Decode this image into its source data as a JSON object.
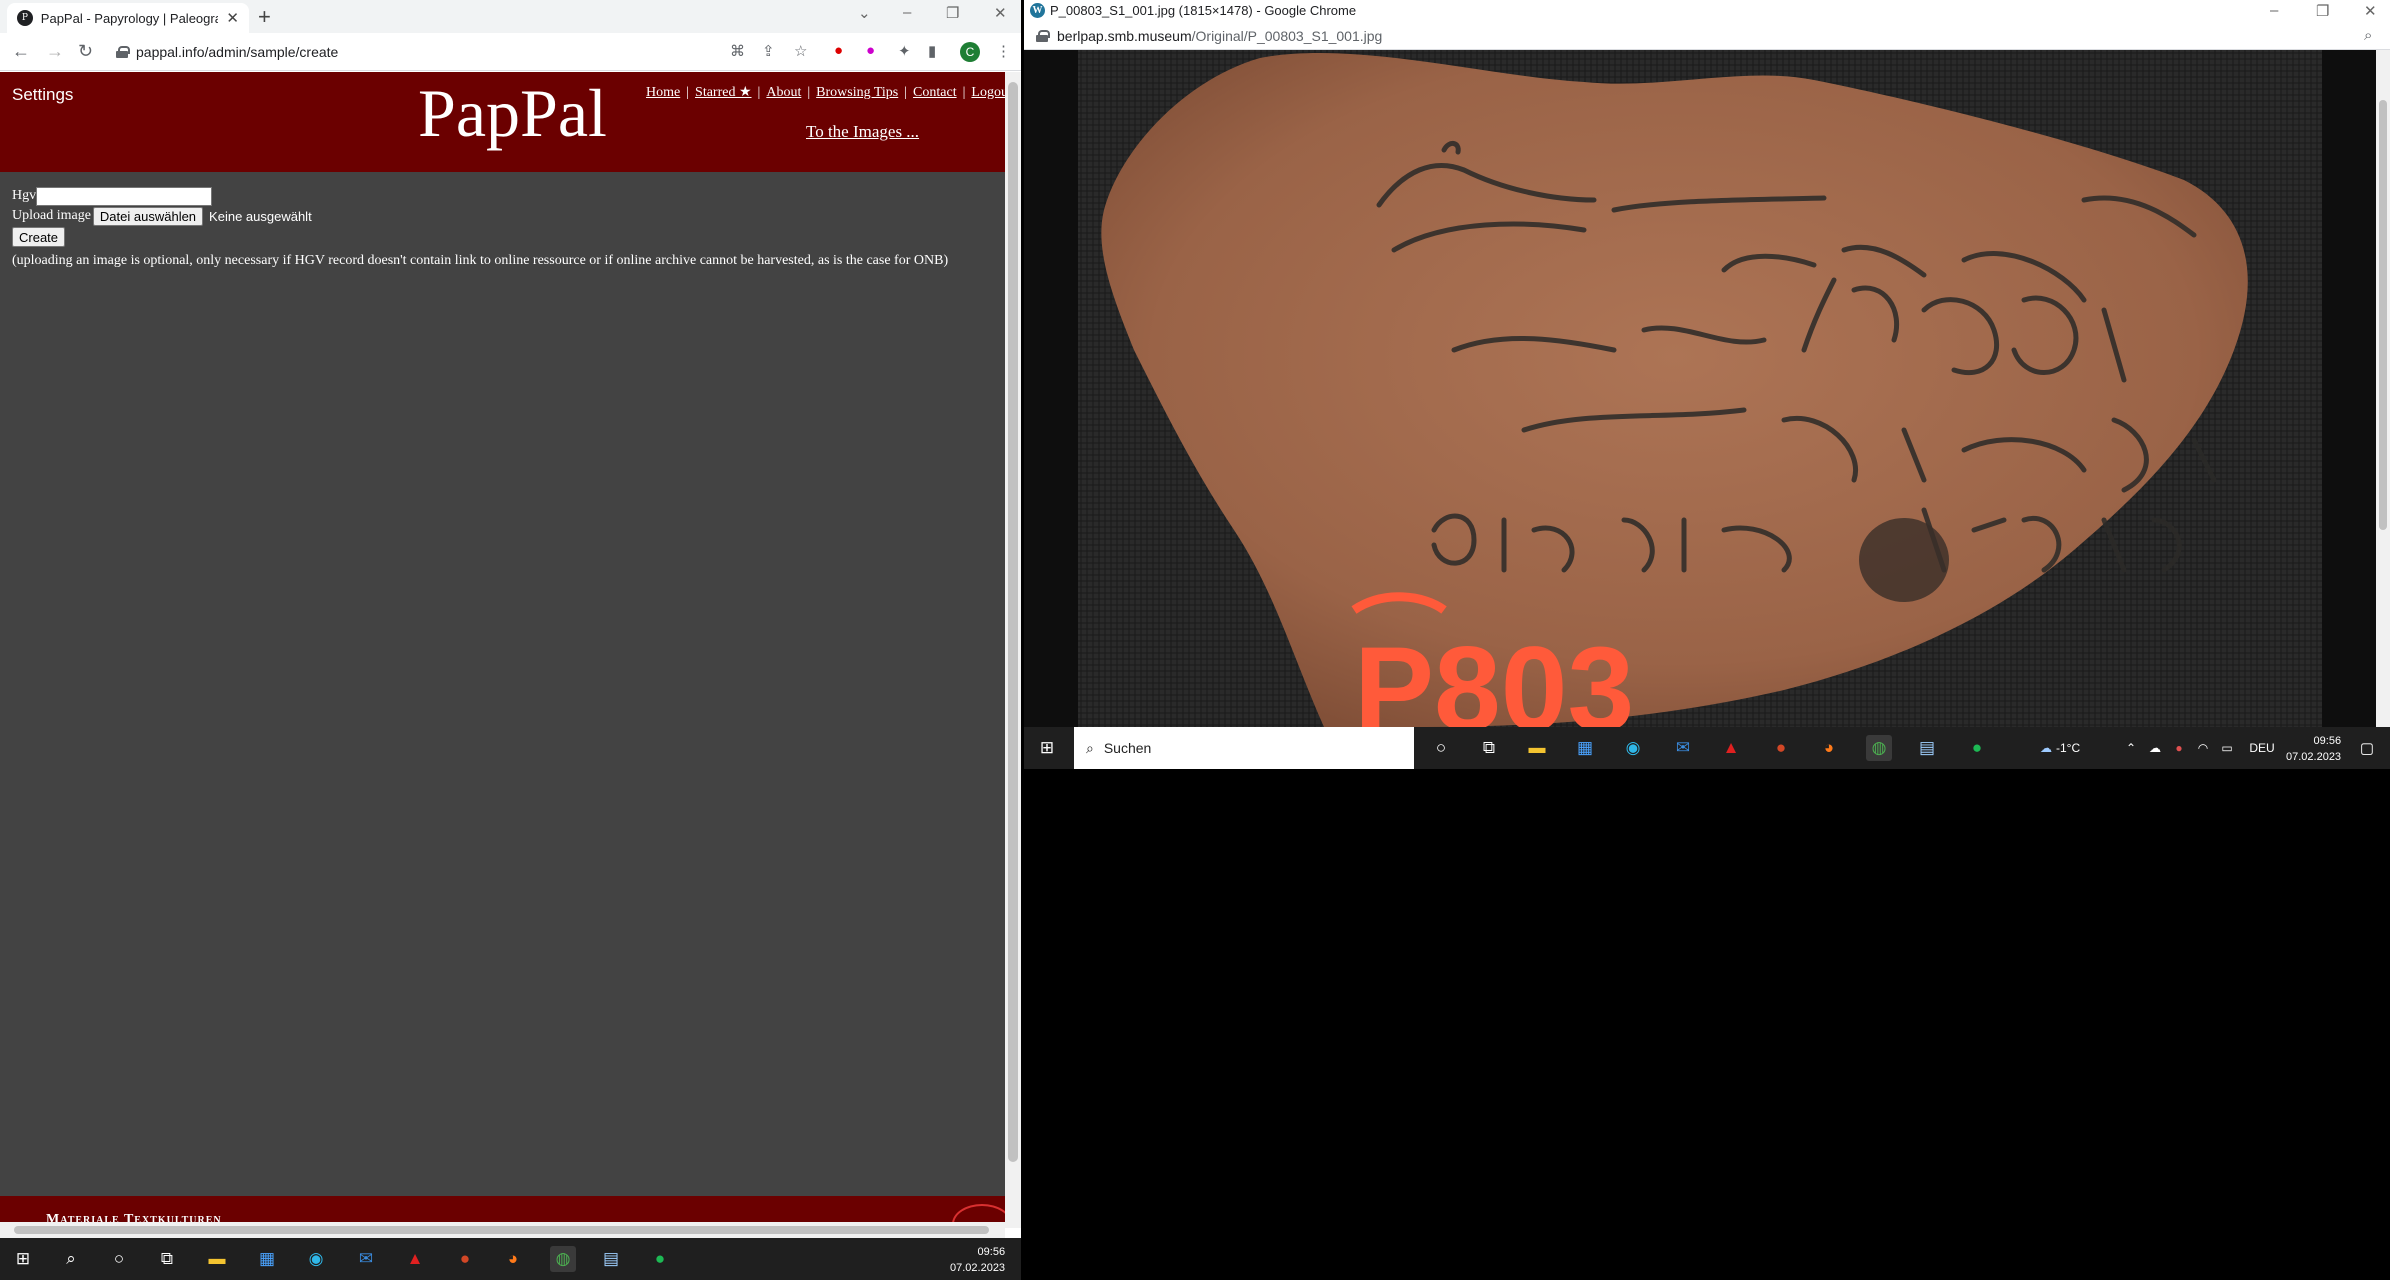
{
  "left_window": {
    "tab_title": "PapPal - Papyrology | Paleograph",
    "tab_favicon": "P",
    "new_tab": "+",
    "url": "pappal.info/admin/sample/create",
    "profile_initial": "C",
    "header": {
      "settings": "Settings",
      "logo": "PapPal",
      "nav": [
        "Home",
        "Starred ★",
        "About",
        "Browsing Tips",
        "Contact",
        "Logout"
      ],
      "nav_separator": "|",
      "to_images": "To the Images ..."
    },
    "form": {
      "hgv_label": "Hgv",
      "hgv_value": "",
      "upload_label": "Upload image",
      "file_button": "Datei auswählen",
      "file_status": "Keine ausgewählt",
      "create_button": "Create",
      "note": "(uploading an image is optional, only necessary if HGV record doesn't contain link to online ressource or if online archive cannot be harvested, as is the case for ONB)"
    },
    "footer": {
      "text": "Materiale Textkulturen"
    },
    "taskbar": {
      "time": "09:56",
      "date": "07.02.2023"
    }
  },
  "right_window": {
    "title": "P_00803_S1_001.jpg (1815×1478) - Google Chrome",
    "favicon": "W",
    "url_host": "berlpap.smb.museum",
    "url_path": "/Original/P_00803_S1_001.jpg",
    "image_stamp": "P803",
    "taskbar": {
      "search_label": "Suchen",
      "weather": "-1°C",
      "language": "DEU",
      "time": "09:56",
      "date": "07.02.2023"
    }
  },
  "colors": {
    "header_red": "#6b0000",
    "page_gray": "#434343",
    "taskbar": "#1f1f1f",
    "shard": "#a0684a",
    "stamp": "#ff5a3a"
  },
  "icons": [
    "windows-start-icon",
    "search-icon",
    "cortana-icon",
    "task-view-icon",
    "file-explorer-icon",
    "store-icon",
    "edge-icon",
    "mail-icon",
    "acrobat-icon",
    "powerpoint-icon",
    "firefox-icon",
    "chrome-icon",
    "notepad-icon",
    "spotify-icon"
  ]
}
